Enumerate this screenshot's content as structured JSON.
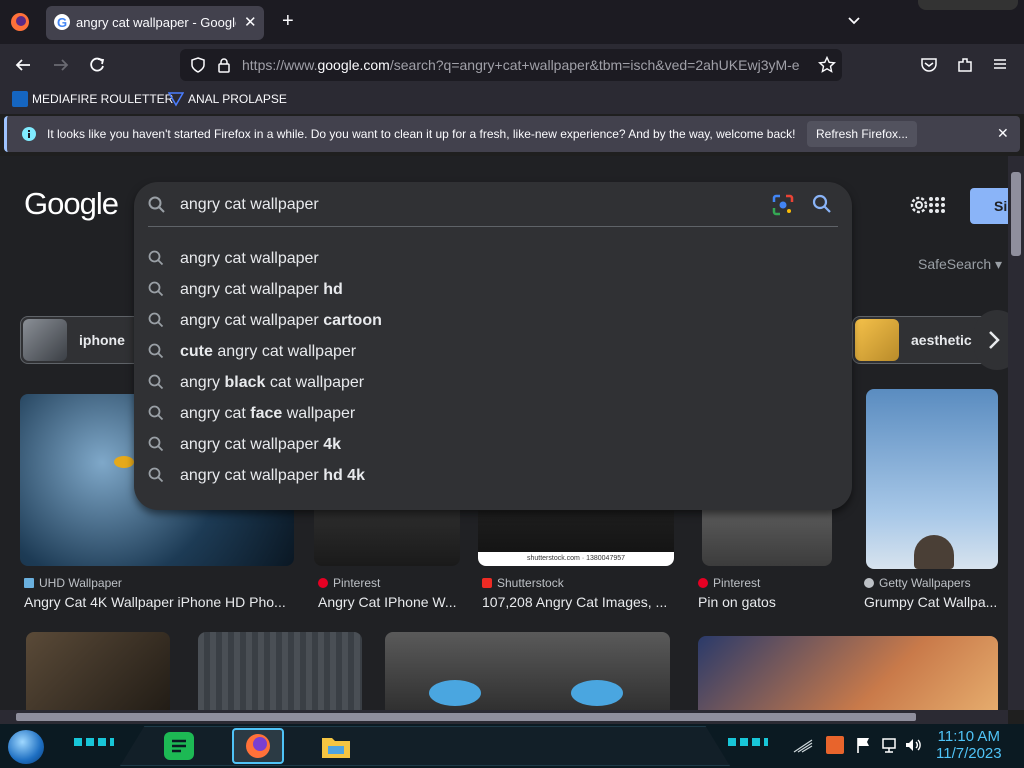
{
  "browser": {
    "tab_title": "angry cat wallpaper - Google Se",
    "new_tab_glyph": "+",
    "url_prefix": "https://www.",
    "url_domain": "google.com",
    "url_rest": "/search?q=angry+cat+wallpaper&tbm=isch&ved=2ahUKEwj3yM-e",
    "bookmarks": [
      "MEDIAFIRE ROULETTER",
      "ANAL PROLAPSE"
    ],
    "infobar_message": "It looks like you haven't started Firefox in a while. Do you want to clean it up for a fresh, like-new experience? And by the way, welcome back!",
    "infobar_button": "Refresh Firefox..."
  },
  "google": {
    "logo": "Google",
    "query": "angry cat wallpaper",
    "suggestions": [
      {
        "plain_before": "angry cat wallpaper",
        "bold": "",
        "plain_after": ""
      },
      {
        "plain_before": "angry cat wallpaper ",
        "bold": "hd",
        "plain_after": ""
      },
      {
        "plain_before": "angry cat wallpaper ",
        "bold": "cartoon",
        "plain_after": ""
      },
      {
        "plain_before": "",
        "bold": "cute",
        "plain_after": " angry cat wallpaper"
      },
      {
        "plain_before": "angry ",
        "bold": "black",
        "plain_after": " cat wallpaper"
      },
      {
        "plain_before": "angry cat ",
        "bold": "face",
        "plain_after": " wallpaper"
      },
      {
        "plain_before": "angry cat wallpaper ",
        "bold": "4k",
        "plain_after": ""
      },
      {
        "plain_before": "angry cat wallpaper ",
        "bold": "hd 4k",
        "plain_after": ""
      }
    ],
    "safesearch": "SafeSearch",
    "signin": "Si",
    "chips": [
      "iphone",
      "aesthetic"
    ],
    "results": [
      {
        "source": "UHD Wallpaper",
        "caption": "Angry Cat 4K Wallpaper iPhone HD Pho..."
      },
      {
        "source": "Pinterest",
        "caption": "Angry Cat IPhone W..."
      },
      {
        "source": "Shutterstock",
        "caption": "107,208 Angry Cat Images, ..."
      },
      {
        "source": "Pinterest",
        "caption": "Pin on gatos"
      },
      {
        "source": "Getty Wallpapers",
        "caption": "Grumpy Cat Wallpa..."
      }
    ],
    "watermark": "shutterstock.com · 1380047957"
  },
  "taskbar": {
    "time": "11:10 AM",
    "date": "11/7/2023"
  },
  "colors": {
    "accent_blue": "#8ab4f8",
    "page_bg": "#202124",
    "clock": "#4fc3f7"
  }
}
